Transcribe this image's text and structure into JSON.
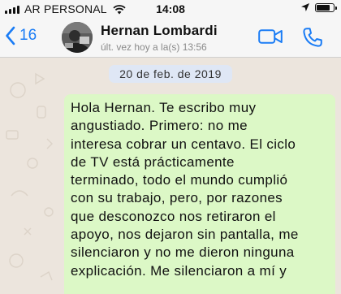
{
  "status_bar": {
    "carrier": "AR PERSONAL",
    "time": "14:08",
    "battery_level": 0.85
  },
  "header": {
    "back_count": "16",
    "contact_name": "Hernan Lombardi",
    "last_seen": "últ. vez hoy a la(s) 13:56",
    "icons": [
      "chevron-left-icon",
      "video-camera-icon",
      "phone-icon"
    ],
    "accent_color": "#1a7cf5"
  },
  "chat": {
    "background_color": "#ece5dd",
    "date_label": "20 de feb. de 2019",
    "message": {
      "bubble_color": "#dcf8c6",
      "lines": [
        "Hola Hernan. Te escribo muy",
        "angustiado. Primero: no me",
        "interesa cobrar un centavo. El ciclo",
        "de TV está prácticamente",
        "terminado, todo el mundo cumplió",
        "con su trabajo, pero, por razones",
        "que desconozco nos retiraron el",
        "apoyo, nos dejaron sin pantalla, me",
        "silenciaron y no me dieron ninguna",
        "explicación. Me silenciaron a mí y"
      ]
    }
  }
}
